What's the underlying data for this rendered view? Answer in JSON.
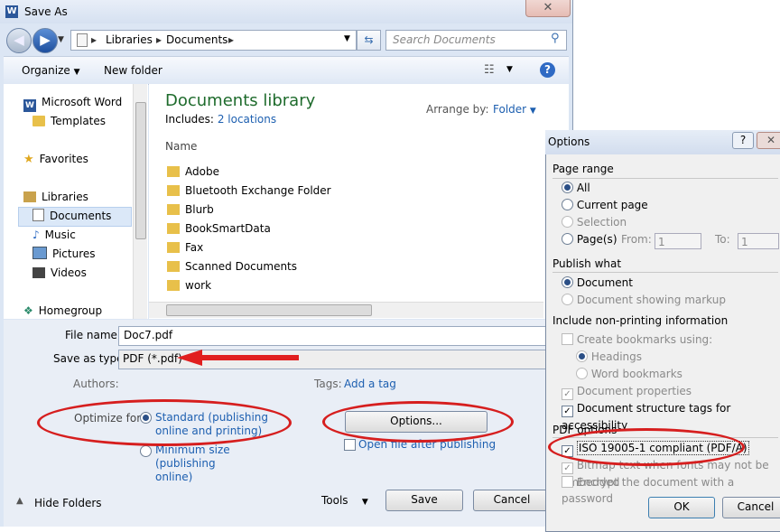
{
  "window": {
    "title": "Save As",
    "close_glyph": "✕"
  },
  "address": {
    "crumbs": [
      "Libraries",
      "Documents"
    ],
    "search_placeholder": "Search Documents"
  },
  "toolbar": {
    "organize": "Organize",
    "new_folder": "New folder",
    "help": "?"
  },
  "nav": {
    "items": [
      {
        "label": "Microsoft Word",
        "icon": "word-icon"
      },
      {
        "label": "Templates",
        "icon": "folder-icon"
      },
      {
        "label": "Favorites",
        "icon": "star-icon"
      },
      {
        "label": "Libraries",
        "icon": "libraries-icon"
      },
      {
        "label": "Documents",
        "icon": "documents-icon",
        "selected": true
      },
      {
        "label": "Music",
        "icon": "music-icon"
      },
      {
        "label": "Pictures",
        "icon": "pictures-icon"
      },
      {
        "label": "Videos",
        "icon": "videos-icon"
      },
      {
        "label": "Homegroup",
        "icon": "homegroup-icon"
      }
    ]
  },
  "library": {
    "title": "Documents library",
    "includes_label": "Includes:",
    "includes_link": "2 locations",
    "arrange_label": "Arrange by:",
    "arrange_value": "Folder",
    "column_name": "Name",
    "files": [
      "Adobe",
      "Bluetooth Exchange Folder",
      "Blurb",
      "BookSmartData",
      "Fax",
      "Scanned Documents",
      "work"
    ]
  },
  "form": {
    "file_name_label": "File name:",
    "file_name_value": "Doc7.pdf",
    "save_type_label": "Save as type:",
    "save_type_value": "PDF (*.pdf)",
    "authors_label": "Authors:",
    "tags_label": "Tags:",
    "tags_link": "Add a tag",
    "optimize_label": "Optimize for:",
    "opt_standard": "Standard (publishing online and printing)",
    "opt_minimum": "Minimum size (publishing online)",
    "options_button": "Options...",
    "open_after": "Open file after publishing",
    "hide_folders": "Hide Folders",
    "tools": "Tools",
    "save": "Save",
    "cancel": "Cancel"
  },
  "options_dialog": {
    "title": "Options",
    "help": "?",
    "close": "✕",
    "page_range": "Page range",
    "all": "All",
    "current_page": "Current page",
    "selection": "Selection",
    "pages": "Page(s)",
    "from": "From:",
    "to": "To:",
    "from_value": "1",
    "to_value": "1",
    "publish_what": "Publish what",
    "document": "Document",
    "doc_markup": "Document showing markup",
    "nonprinting": "Include non-printing information",
    "create_bookmarks": "Create bookmarks using:",
    "headings": "Headings",
    "word_bookmarks": "Word bookmarks",
    "doc_properties": "Document properties",
    "struct_tags": "Document structure tags for accessibility",
    "pdf_options": "PDF options",
    "iso": "ISO 19005-1 compliant (PDF/A)",
    "bitmap": "Bitmap text when fonts may not be embedded",
    "encrypt": "Encrypt the document with a password",
    "ok": "OK",
    "cancel": "Cancel"
  }
}
